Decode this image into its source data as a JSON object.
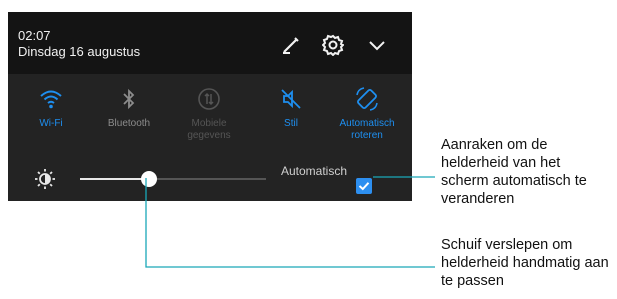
{
  "status": {
    "time": "02:07",
    "date": "Dinsdag 16 augustus"
  },
  "header_icons": [
    "pencil-edit-icon",
    "gear-icon",
    "chevron-down-icon"
  ],
  "tiles": [
    {
      "name": "wifi",
      "label": "Wi-Fi",
      "state": "on"
    },
    {
      "name": "bluetooth",
      "label": "Bluetooth",
      "state": "off"
    },
    {
      "name": "mobile-data",
      "label": "Mobiele gegevens",
      "state": "disabled"
    },
    {
      "name": "silent",
      "label": "Stil",
      "state": "on"
    },
    {
      "name": "auto-rotate",
      "label": "Automatisch roteren",
      "state": "on"
    }
  ],
  "brightness": {
    "level": 0.37,
    "auto_label": "Automatisch",
    "auto_checked": true
  },
  "callouts": {
    "auto": "Aanraken om de helderheid van het scherm automatisch te veranderen",
    "slider": "Schuif verslepen om helderheid handmatig aan te passen"
  },
  "colors": {
    "accent": "#1e8ff0",
    "leader_line": "#1aa8b8",
    "panel_bg": "#1b1b1b"
  }
}
